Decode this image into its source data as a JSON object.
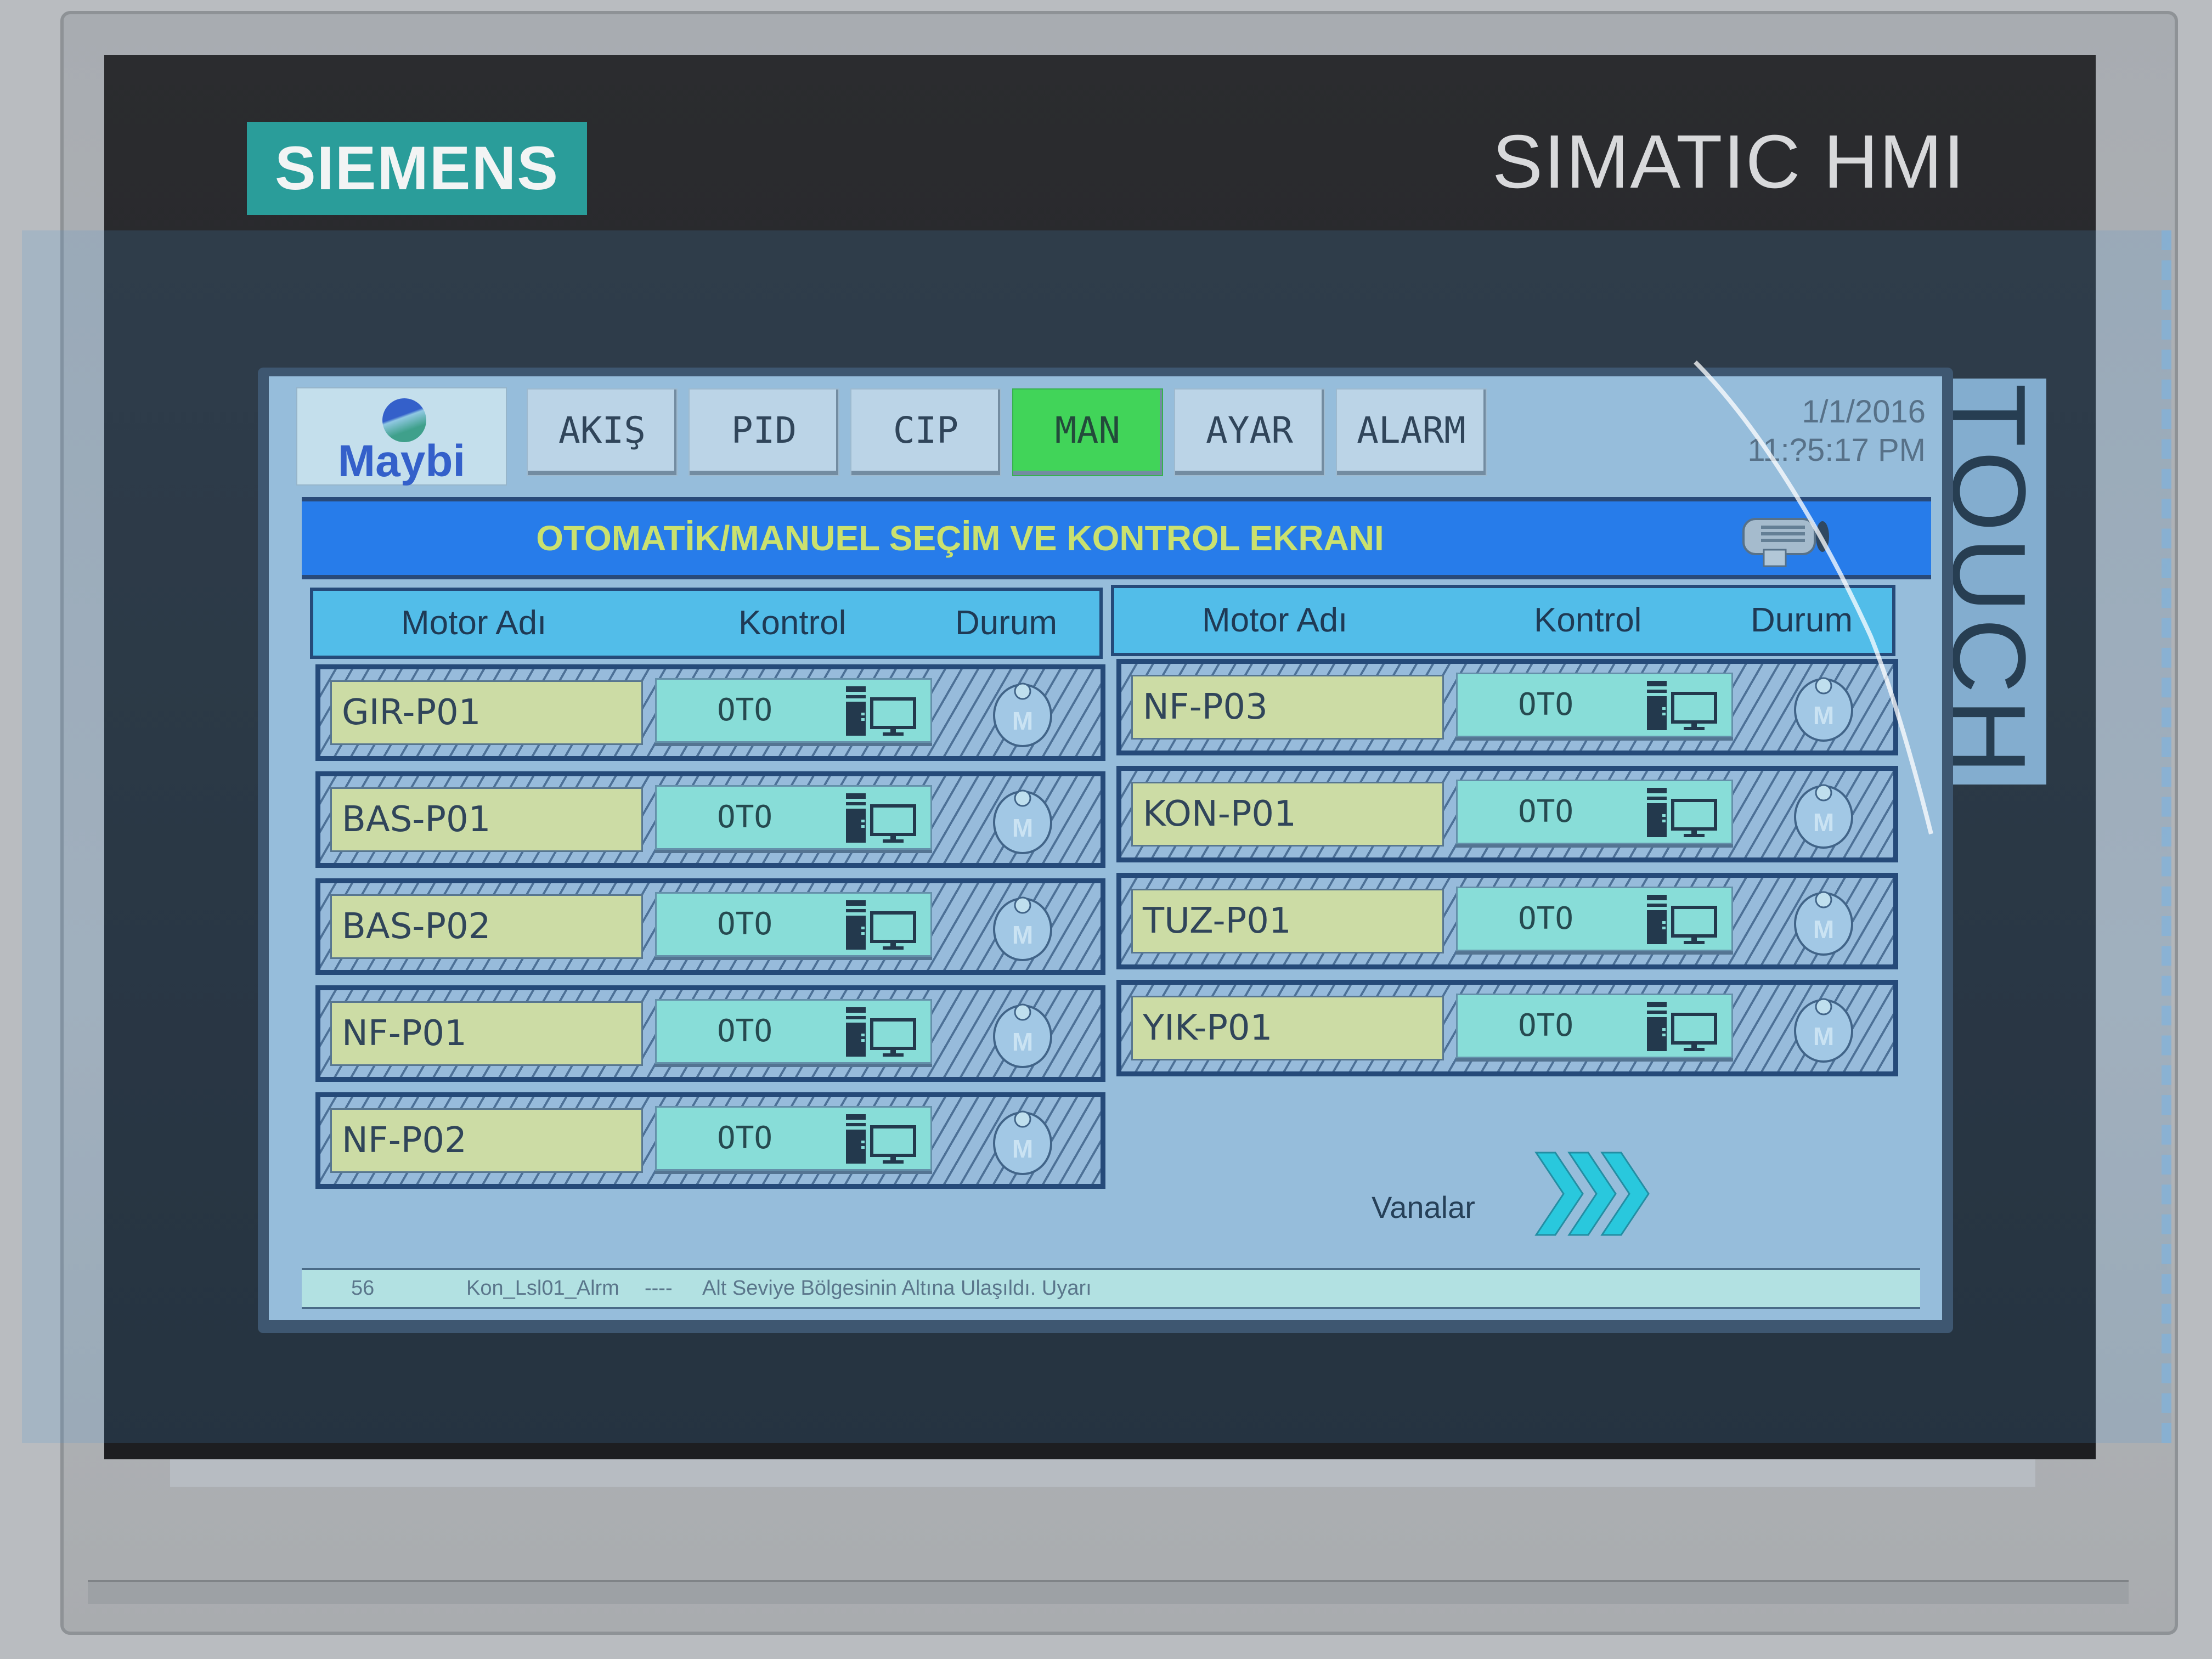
{
  "device": {
    "brand": "SIEMENS",
    "model_label": "SIMATIC HMI",
    "touch_label": "TOUCH",
    "colors": {
      "brand_teal": "#2a9d9a",
      "bezel": "#1d1e21",
      "housing": "#b3b6ba"
    }
  },
  "hmi": {
    "logo": {
      "text": "Maybi",
      "icon": "maybi-globe-icon"
    },
    "nav_tabs": [
      {
        "label": "AKIŞ",
        "active": false
      },
      {
        "label": "PID",
        "active": false
      },
      {
        "label": "CIP",
        "active": false
      },
      {
        "label": "MAN",
        "active": true
      },
      {
        "label": "AYAR",
        "active": false
      },
      {
        "label": "ALARM",
        "active": false
      }
    ],
    "datetime": {
      "date": "1/1/2016",
      "time": "11:?5:17 PM"
    },
    "title": "OTOMATİK/MANUEL SEÇİM VE KONTROL EKRANI",
    "title_icon": "motor-icon",
    "columns": {
      "name": "Motor Adı",
      "control": "Kontrol",
      "status": "Durum"
    },
    "left_motors": [
      {
        "name": "GIR-P01",
        "control": "OTO",
        "control_icon": "computer-icon",
        "status_icon": "manual-m-icon"
      },
      {
        "name": "BAS-P01",
        "control": "OTO",
        "control_icon": "computer-icon",
        "status_icon": "manual-m-icon"
      },
      {
        "name": "BAS-P02",
        "control": "OTO",
        "control_icon": "computer-icon",
        "status_icon": "manual-m-icon"
      },
      {
        "name": "NF-P01",
        "control": "OTO",
        "control_icon": "computer-icon",
        "status_icon": "manual-m-icon"
      },
      {
        "name": "NF-P02",
        "control": "OTO",
        "control_icon": "computer-icon",
        "status_icon": "manual-m-icon"
      }
    ],
    "right_motors": [
      {
        "name": "NF-P03",
        "control": "OTO",
        "control_icon": "computer-icon",
        "status_icon": "manual-m-icon"
      },
      {
        "name": "KON-P01",
        "control": "OTO",
        "control_icon": "computer-icon",
        "status_icon": "manual-m-icon"
      },
      {
        "name": "TUZ-P01",
        "control": "OTO",
        "control_icon": "computer-icon",
        "status_icon": "manual-m-icon"
      },
      {
        "name": "YIK-P01",
        "control": "OTO",
        "control_icon": "computer-icon",
        "status_icon": "manual-m-icon"
      }
    ],
    "next_page": {
      "label": "Vanalar",
      "icon": "triple-chevron-right-icon"
    },
    "alarm": {
      "number": "56",
      "tag": "Kon_Lsl01_Alrm",
      "separator": "----",
      "message": "Alt Seviye Bölgesinin Altına Ulaşıldı. Uyarı"
    },
    "colors": {
      "active_tab": "#3fe23f",
      "title_bar": "#1f77f0",
      "title_text": "#e6f25a",
      "header_bg": "#54c6ee",
      "name_cell": "#e8ec9c",
      "control_cell": "#95edd9",
      "chevron": "#22d4e0"
    }
  }
}
